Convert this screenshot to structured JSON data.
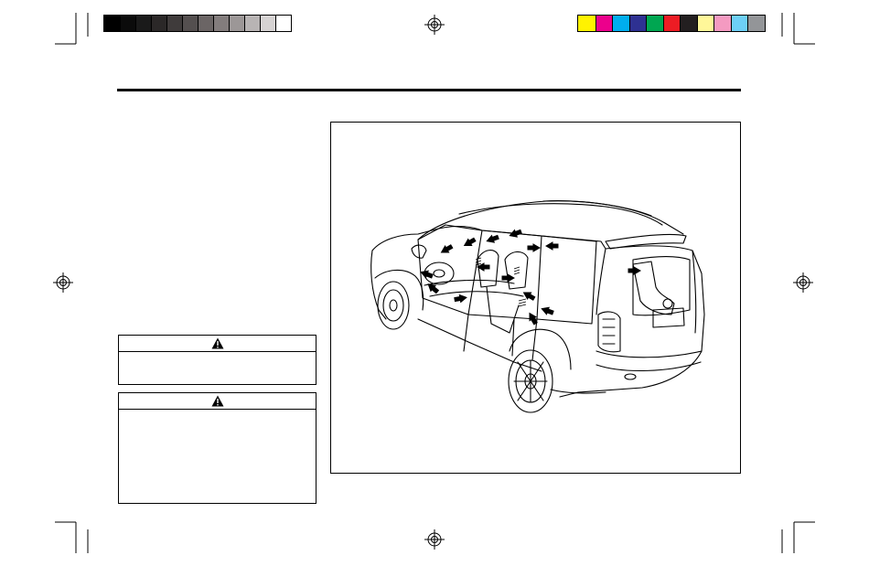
{
  "print_marks": {
    "gray_swatches": [
      "#000000",
      "#0b0b0b",
      "#1a1a1a",
      "#2b2828",
      "#3f3b3b",
      "#544f4f",
      "#6b6565",
      "#837d7d",
      "#9c9797",
      "#b8b4b4",
      "#d6d3d3",
      "#ffffff"
    ],
    "color_swatches": [
      "#fff200",
      "#ec008c",
      "#00aeef",
      "#2e3192",
      "#00a651",
      "#ed1c24",
      "#231f20",
      "#fff799",
      "#f49ac1",
      "#6dcff6",
      "#939598"
    ]
  },
  "warning_boxes": [
    {
      "icon": "warning-triangle-icon",
      "body": ""
    },
    {
      "icon": "warning-triangle-icon",
      "body": ""
    }
  ],
  "figure": {
    "illustration": "suv-air-vent-diagram"
  }
}
